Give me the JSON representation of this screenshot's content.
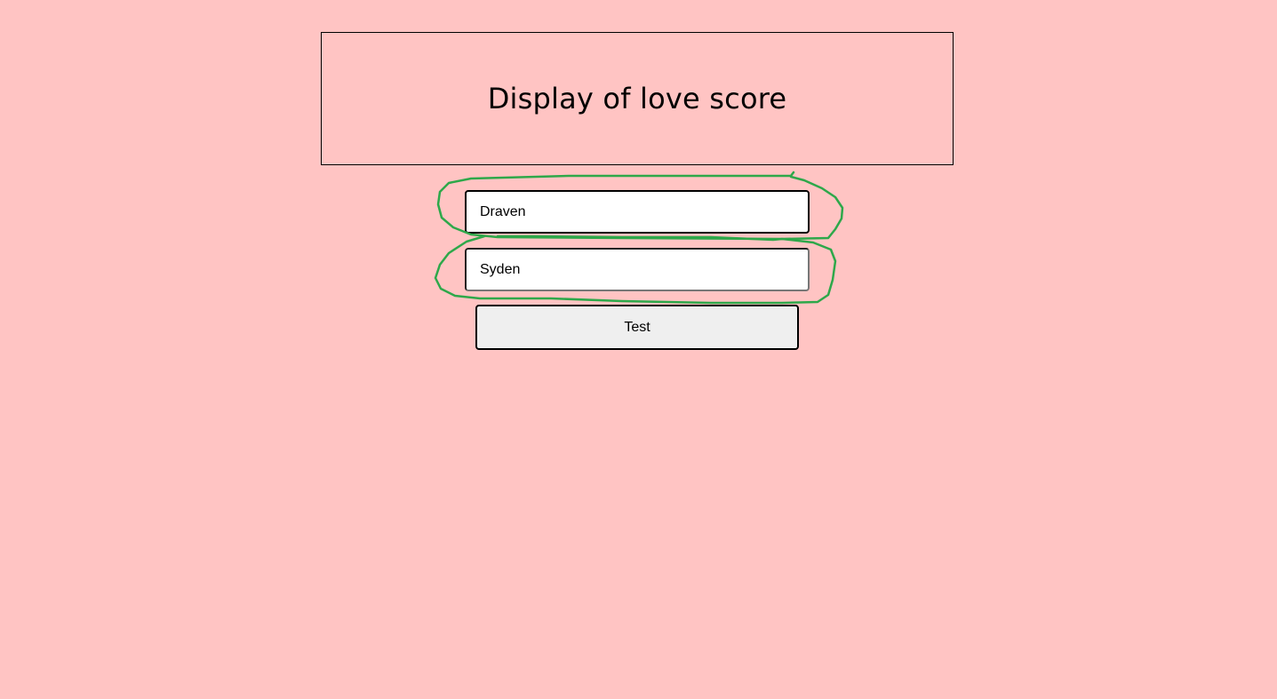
{
  "score_display": {
    "title": "Display of love score"
  },
  "form": {
    "name1_value": "Draven",
    "name2_value": "Syden",
    "test_button_label": "Test"
  },
  "colors": {
    "background": "#ffc4c3",
    "annotation_stroke": "#2ea84a"
  }
}
